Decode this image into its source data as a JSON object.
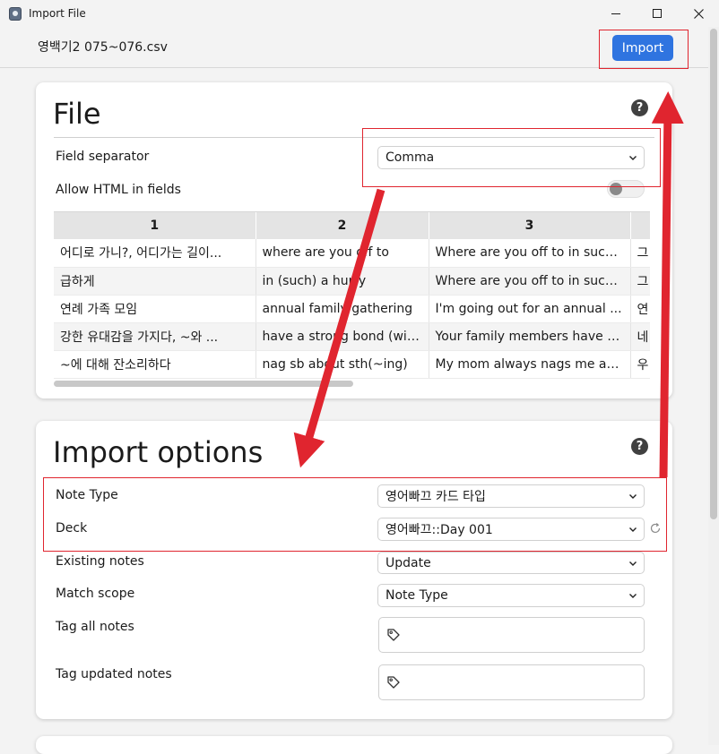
{
  "window": {
    "title": "Import File"
  },
  "header": {
    "filename": "영백기2 075~076.csv",
    "import_label": "Import"
  },
  "file_section": {
    "title": "File",
    "field_separator_label": "Field separator",
    "field_separator_value": "Comma",
    "allow_html_label": "Allow HTML in fields",
    "allow_html_enabled": false,
    "table": {
      "columns": [
        "1",
        "2",
        "3",
        ""
      ],
      "rows": [
        [
          "어디로 가니?, 어디가는 길이...",
          "where are you off to",
          "Where are you off to in such...",
          "그"
        ],
        [
          "급하게",
          "in (such) a hurry",
          "Where are you off to in such...",
          "그"
        ],
        [
          "연례 가족 모임",
          "annual family gathering",
          "I'm going out for an annual ...",
          "연"
        ],
        [
          "강한 유대감을 가지다, ~와 ...",
          "have a strong bond (with)",
          "Your family members have a...",
          "네"
        ],
        [
          "~에 대해 잔소리하다",
          "nag sb about sth(~ing)",
          "My mom always nags me ab...",
          "우"
        ]
      ]
    }
  },
  "import_options": {
    "title": "Import options",
    "note_type_label": "Note Type",
    "note_type_value": "영어빠끄 카드 타입",
    "deck_label": "Deck",
    "deck_value": "영어빠끄::Day 001",
    "existing_notes_label": "Existing notes",
    "existing_notes_value": "Update",
    "match_scope_label": "Match scope",
    "match_scope_value": "Note Type",
    "tag_all_label": "Tag all notes",
    "tag_updated_label": "Tag updated notes"
  },
  "icons": {
    "help": "help-icon",
    "tag": "tag-icon",
    "refresh": "refresh-icon",
    "chevron": "chevron-down-icon"
  },
  "colors": {
    "accent": "#2f74e0",
    "annotation": "#e0252f"
  }
}
